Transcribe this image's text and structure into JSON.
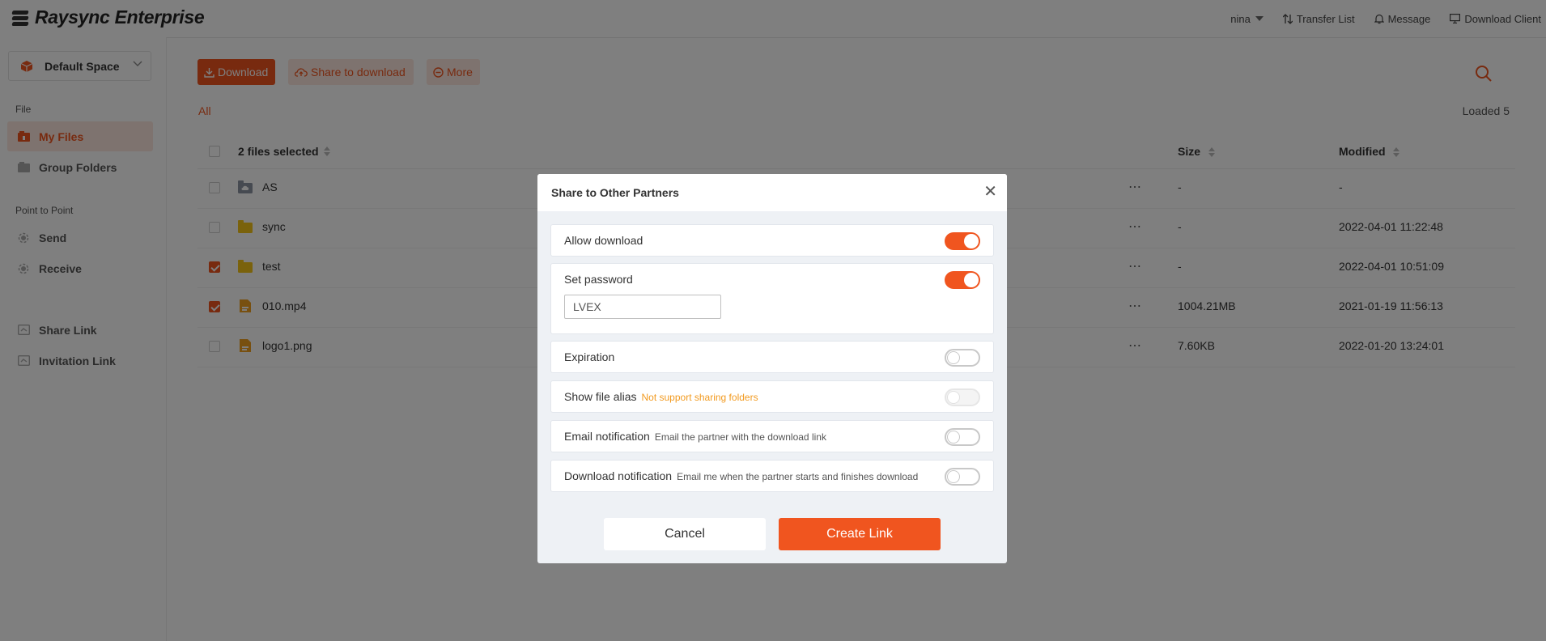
{
  "header": {
    "app_name": "Raysync Enterprise",
    "user": "nina",
    "transfer_list": "Transfer List",
    "message": "Message",
    "download_client": "Download Client"
  },
  "sidebar": {
    "space": "Default Space",
    "section_file": "File",
    "my_files": "My Files",
    "group_folders": "Group Folders",
    "section_p2p": "Point to Point",
    "send": "Send",
    "receive": "Receive",
    "share_link": "Share Link",
    "invitation_link": "Invitation Link"
  },
  "toolbar": {
    "download": "Download",
    "share_to_download": "Share to download",
    "more": "More"
  },
  "breadcrumb": "All",
  "loaded": "Loaded 5",
  "table": {
    "header_name": "2 files selected",
    "header_size": "Size",
    "header_modified": "Modified",
    "rows": [
      {
        "name": "AS",
        "size": "-",
        "modified": "-",
        "checked": false,
        "icon": "cloud-folder-icon"
      },
      {
        "name": "sync",
        "size": "-",
        "modified": "2022-04-01 11:22:48",
        "checked": false,
        "icon": "folder-icon"
      },
      {
        "name": "test",
        "size": "-",
        "modified": "2022-04-01 10:51:09",
        "checked": true,
        "icon": "folder-icon"
      },
      {
        "name": "010.mp4",
        "size": "1004.21MB",
        "modified": "2021-01-19 11:56:13",
        "checked": true,
        "icon": "file-icon"
      },
      {
        "name": "logo1.png",
        "size": "7.60KB",
        "modified": "2022-01-20 13:24:01",
        "checked": false,
        "icon": "file-icon"
      }
    ]
  },
  "modal": {
    "title": "Share to Other Partners",
    "allow_download": "Allow download",
    "set_password": "Set password",
    "password_value": "LVEX",
    "expiration": "Expiration",
    "show_file_alias": "Show file alias",
    "show_file_alias_hint": "Not support sharing folders",
    "email_notification": "Email notification",
    "email_notification_hint": "Email the partner with the download link",
    "download_notification": "Download notification",
    "download_notification_hint": "Email me when the partner starts and finishes download",
    "cancel": "Cancel",
    "create_link": "Create Link"
  },
  "colors": {
    "accent": "#f0551f",
    "accent_light": "#fde7de",
    "warning": "#f29a1f"
  }
}
